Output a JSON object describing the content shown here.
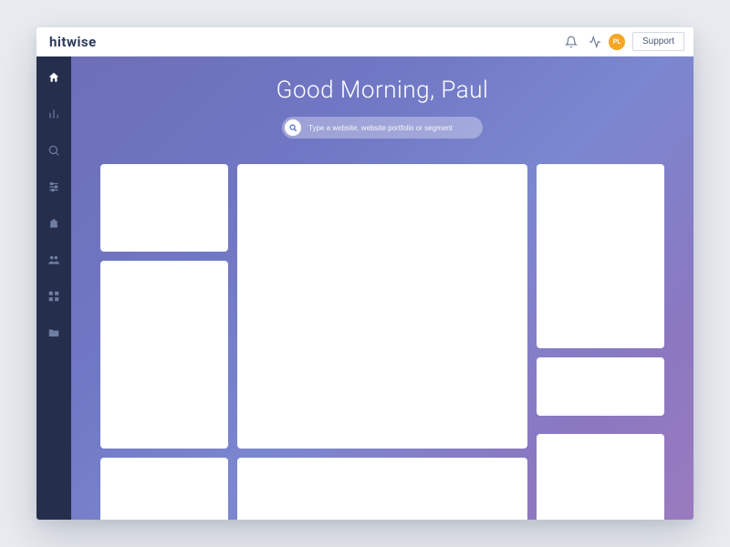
{
  "brand": "hitwise",
  "header": {
    "support_label": "Support",
    "avatar_initials": "PL"
  },
  "sidebar": {
    "items": [
      {
        "name": "home",
        "icon": "home-icon",
        "active": true
      },
      {
        "name": "analytics",
        "icon": "chart-icon",
        "active": false
      },
      {
        "name": "search",
        "icon": "search-icon",
        "active": false
      },
      {
        "name": "settings",
        "icon": "sliders-icon",
        "active": false
      },
      {
        "name": "shopping",
        "icon": "bag-icon",
        "active": false
      },
      {
        "name": "audience",
        "icon": "people-icon",
        "active": false
      },
      {
        "name": "apps",
        "icon": "grid-icon",
        "active": false
      },
      {
        "name": "files",
        "icon": "folder-icon",
        "active": false
      }
    ]
  },
  "main": {
    "greeting": "Good Morning, Paul",
    "search_placeholder": "Type a website, website portfolio or segment"
  },
  "colors": {
    "sidebar_bg": "#252f4d",
    "accent": "#4a68d9",
    "avatar": "#f5a623"
  }
}
